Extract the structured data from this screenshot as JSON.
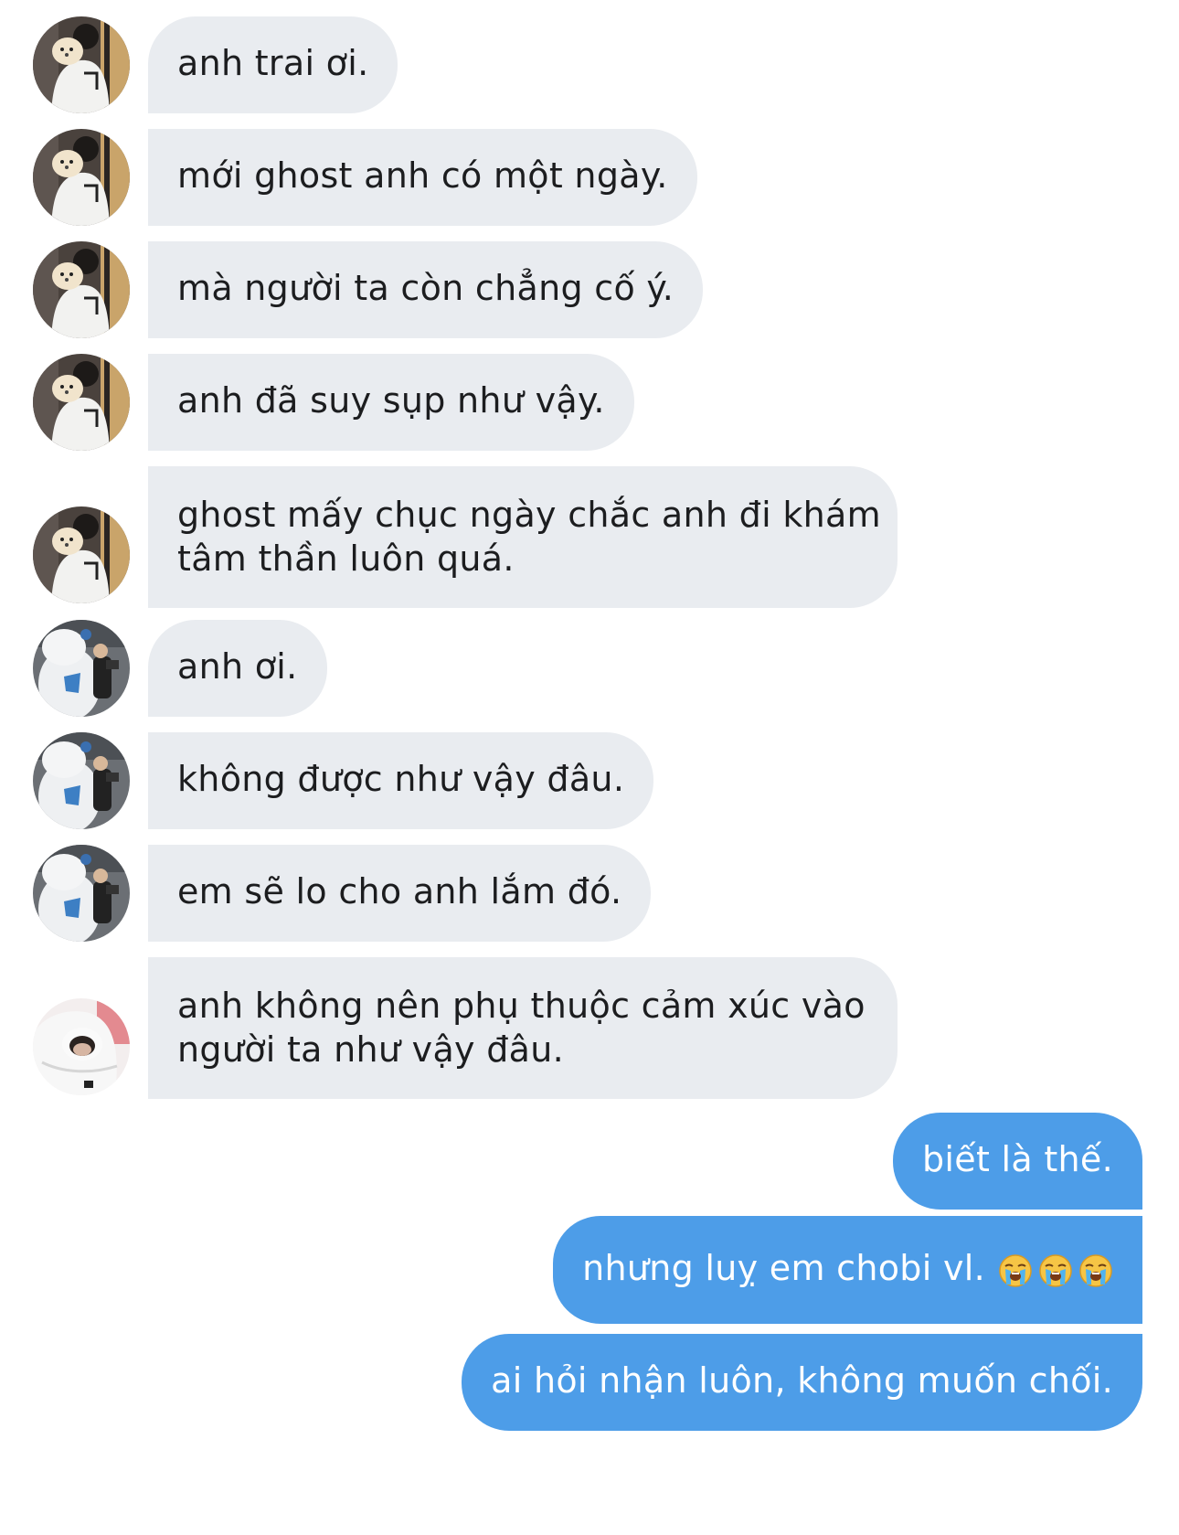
{
  "messages": [
    {
      "sender": "other",
      "avatar": "avatar-dog-photo",
      "text": "anh trai ơi."
    },
    {
      "sender": "other",
      "avatar": "avatar-dog-photo",
      "text": "mới ghost anh có một ngày."
    },
    {
      "sender": "other",
      "avatar": "avatar-dog-photo",
      "text": "mà người ta còn chẳng cố ý."
    },
    {
      "sender": "other",
      "avatar": "avatar-dog-photo",
      "text": "anh đã suy sụp như vậy."
    },
    {
      "sender": "other",
      "avatar": "avatar-dog-photo",
      "text_line1": "ghost mấy chục ngày chắc anh đi khám",
      "text_line2": "tâm thần luôn quá."
    },
    {
      "sender": "other",
      "avatar": "avatar-mascot-photo",
      "text": "anh ơi."
    },
    {
      "sender": "other",
      "avatar": "avatar-mascot-photo",
      "text": "không được như vậy đâu."
    },
    {
      "sender": "other",
      "avatar": "avatar-mascot-photo",
      "text": "em sẽ lo cho anh lắm đó."
    },
    {
      "sender": "other",
      "avatar": "avatar-hoodie-photo",
      "text_line1": "anh không nên phụ thuộc cảm xúc vào",
      "text_line2": "người ta như vậy đâu."
    },
    {
      "sender": "me",
      "text": "biết là thế."
    },
    {
      "sender": "me",
      "text": "nhưng luỵ em chobi vl.",
      "emoji": [
        "loudly-crying-face-icon",
        "loudly-crying-face-icon",
        "loudly-crying-face-icon"
      ]
    },
    {
      "sender": "me",
      "text": "ai hỏi nhận luôn, không muốn chối."
    }
  ],
  "colors": {
    "incoming_bubble": "#e9ecf0",
    "incoming_text": "#1c1d1f",
    "outgoing_bubble": "#4d9de8",
    "outgoing_text": "#ffffff"
  }
}
